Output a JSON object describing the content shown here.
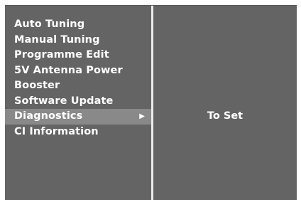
{
  "menu": {
    "items": [
      {
        "label": "Auto Tuning"
      },
      {
        "label": "Manual Tuning"
      },
      {
        "label": "Programme Edit"
      },
      {
        "label": "5V Antenna Power"
      },
      {
        "label": "Booster"
      },
      {
        "label": "Software Update"
      },
      {
        "label": "Diagnostics",
        "arrow": "▶"
      },
      {
        "label": "CI Information"
      }
    ],
    "selected_label": "Diagnostics"
  },
  "detail": {
    "value": "To Set"
  },
  "colors": {
    "panel_background": "#646464",
    "selected_highlight": "#898989",
    "divider": "#ececec",
    "text": "#ffffff"
  },
  "icons": {
    "submenu_arrow": "right-triangle-icon"
  }
}
